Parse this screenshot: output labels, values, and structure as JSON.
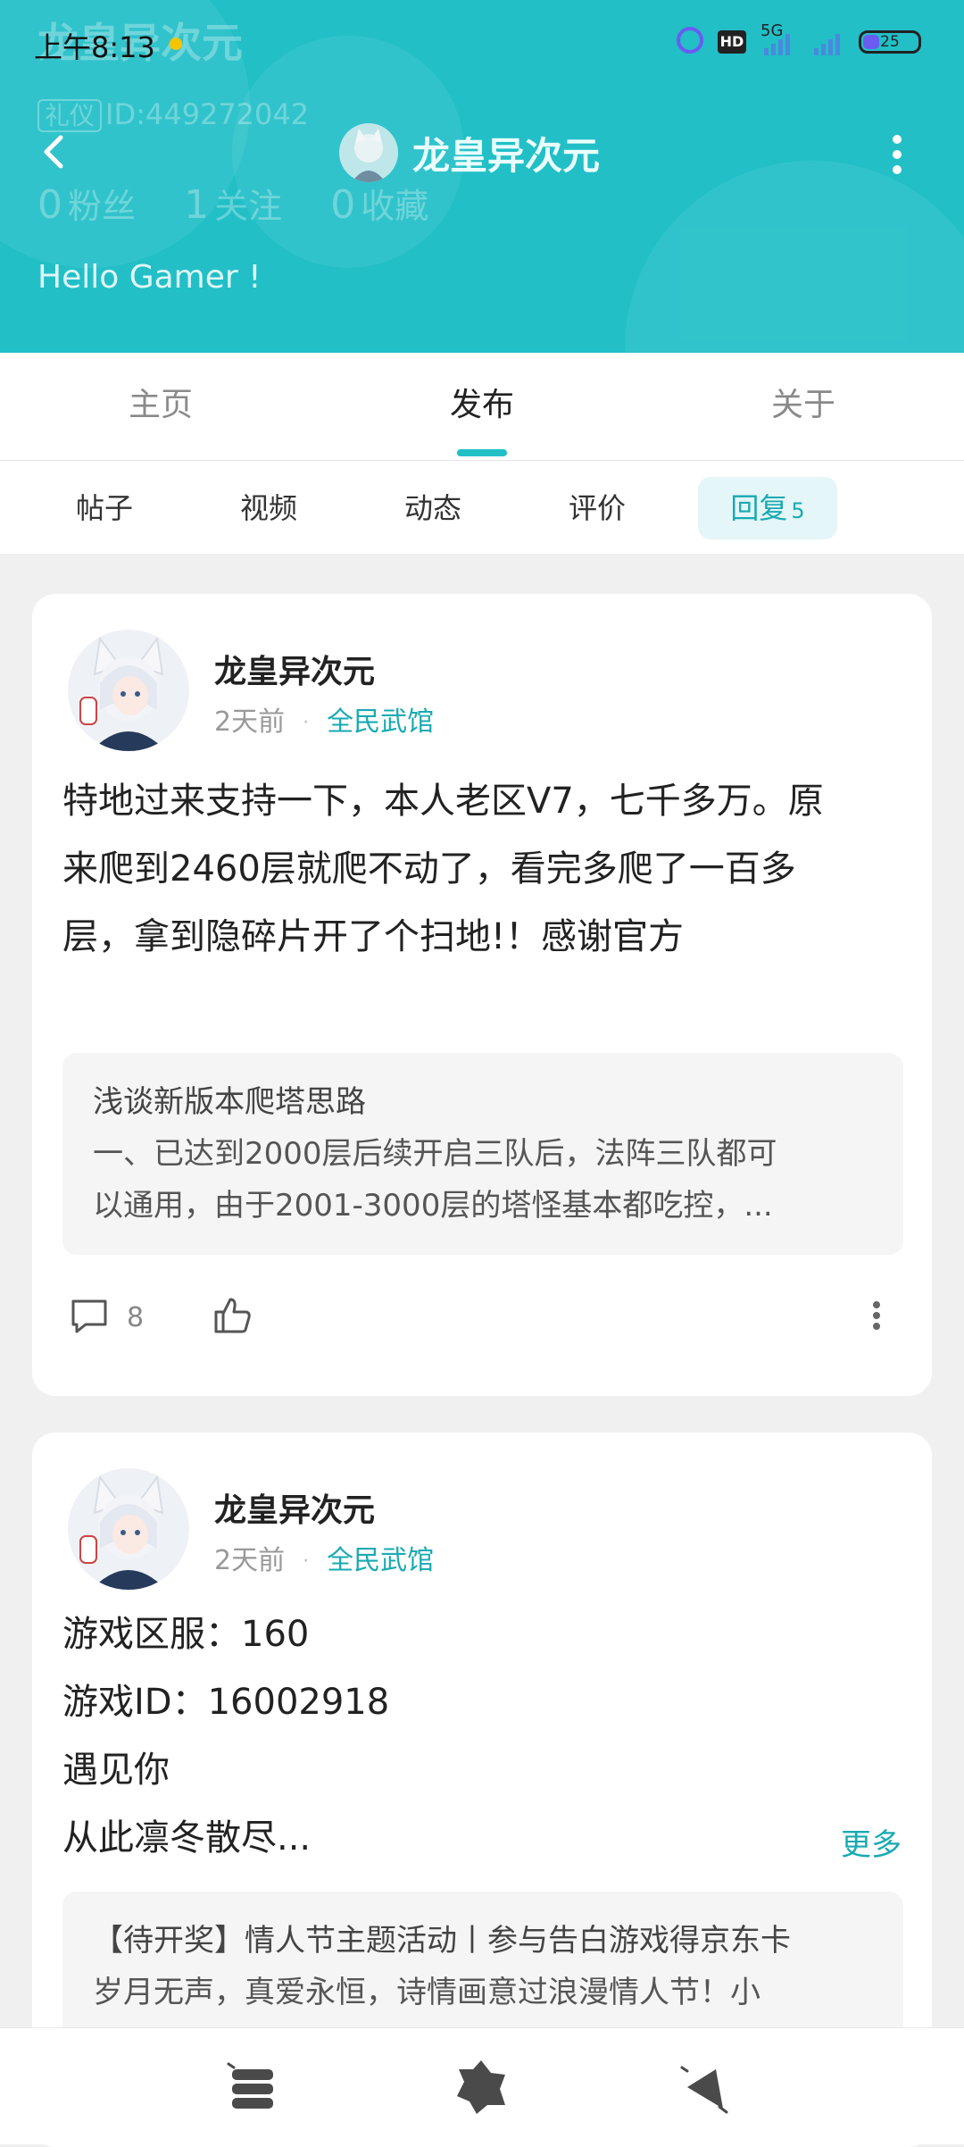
{
  "status_bar": {
    "time": "上午8:13",
    "network": "5G",
    "battery": "25"
  },
  "profile": {
    "name": "龙皇异次元",
    "id_tag": "礼仪",
    "id_text": "ID:449272042",
    "fans_count": "0",
    "fans_label": "粉丝",
    "following_count": "1",
    "following_label": "关注",
    "favorites_count": "0",
    "favorites_label": "收藏",
    "bio": "Hello Gamer !"
  },
  "tabs": [
    {
      "label": "主页"
    },
    {
      "label": "发布"
    },
    {
      "label": "关于"
    }
  ],
  "subtabs": [
    {
      "label": "帖子"
    },
    {
      "label": "视频"
    },
    {
      "label": "动态"
    },
    {
      "label": "评价"
    },
    {
      "label": "回复",
      "count": "5"
    }
  ],
  "posts": [
    {
      "author": "龙皇异次元",
      "time": "2天前",
      "separator": "·",
      "forum": "全民武馆",
      "lines": [
        "特地过来支持一下，本人老区V7，七千多万。原",
        "来爬到2460层就爬不动了，看完多爬了一百多",
        "层，拿到隐碎片开了个扫地!！感谢官方"
      ],
      "quote_title": "浅谈新版本爬塔思路",
      "quote_lines": [
        "一、已达到2000层后续开启三队后，法阵三队都可",
        "以通用，由于2001-3000层的塔怪基本都吃控，..."
      ],
      "comment_count": "8"
    },
    {
      "author": "龙皇异次元",
      "time": "2天前",
      "separator": "·",
      "forum": "全民武馆",
      "lines": [
        "游戏区服：160",
        "游戏ID：16002918",
        "遇见你",
        "从此凛冬散尽..."
      ],
      "more_label": "更多",
      "quote_title": "【待开奖】情人节主题活动丨参与告白游戏得京东卡",
      "quote_lines": [
        "岁月无声，真爱永恒，诗情画意过浪漫情人节！小"
      ]
    }
  ],
  "colors": {
    "accent": "#22bfc7",
    "link": "#19aab2",
    "background": "#f0f0f0"
  },
  "icons": [
    "back-arrow-icon",
    "more-vertical-icon",
    "comment-icon",
    "like-icon",
    "more-icon",
    "menu-stack-icon",
    "game-icon",
    "megaphone-icon"
  ]
}
